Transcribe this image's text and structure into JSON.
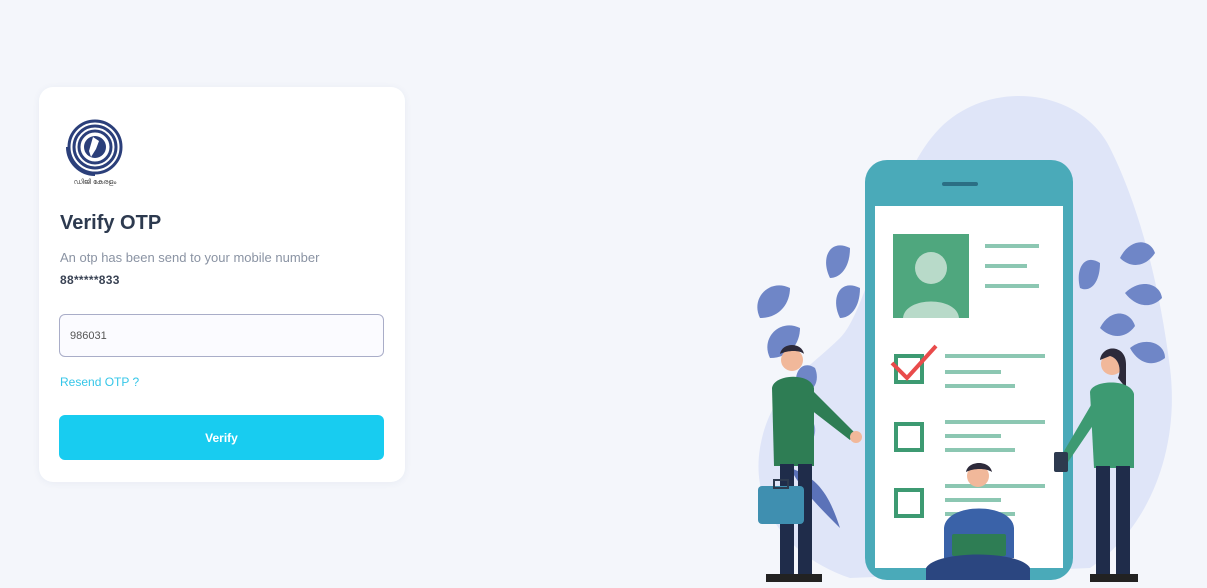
{
  "logo": {
    "icon": "ring-emblem-logo",
    "caption": "ഡിജി കേരളം"
  },
  "form": {
    "title": "Verify OTP",
    "subtitle": "An otp has been send to your mobile number",
    "masked_number": "88*****833",
    "otp_value": "986031",
    "resend_label": "Resend OTP ?",
    "verify_label": "Verify"
  },
  "colors": {
    "background": "#f4f6fb",
    "accent": "#18ccf0",
    "link": "#35c6e8",
    "title": "#2d3a4f",
    "phone_teal": "#4aaab9",
    "check_green": "#3d9a72",
    "check_red": "#e94b4b"
  },
  "illustration": {
    "icon": "otp-verification-illustration"
  }
}
